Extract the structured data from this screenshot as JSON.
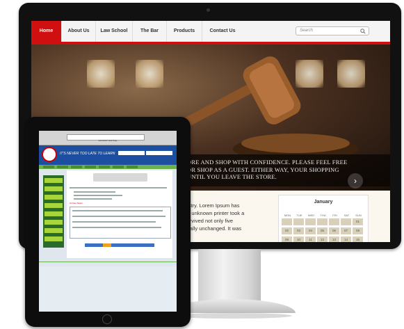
{
  "site": {
    "nav": {
      "items": [
        {
          "label": "Home",
          "active": true
        },
        {
          "label": "About Us",
          "active": false
        },
        {
          "label": "Law School",
          "active": false
        },
        {
          "label": "The Bar",
          "active": false
        },
        {
          "label": "Products",
          "active": false
        },
        {
          "label": "Contact Us",
          "active": false
        }
      ],
      "search_placeholder": "Search"
    },
    "hero": {
      "caption_lines": [
        "ORE AND SHOP WITH CONFIDENCE. PLEASE FEEL FREE",
        "OR SHOP AS A GUEST. EITHER WAY, YOUR SHOPPING",
        "UNTIL YOU LEAVE THE STORE."
      ]
    },
    "lorem_lines": [
      "lustry. Lorem Ipsum has",
      "an unknown printer took a",
      "survived not only five",
      "ntially unchanged. It was"
    ],
    "calendar": {
      "month": "January",
      "days": [
        "MON",
        "TUE",
        "WED",
        "THU",
        "FRI",
        "SAT",
        "SUN"
      ],
      "cells": [
        "",
        "",
        "",
        "",
        "",
        "",
        "01",
        "02",
        "03",
        "04",
        "05",
        "06",
        "07",
        "08",
        "09",
        "10",
        "11",
        "12",
        "13",
        "14",
        "15"
      ]
    }
  },
  "tablet": {
    "tab_title": "FANTAST Test Prep",
    "slogan": "IT'S NEVER TOO LATE TO LEARN",
    "notes_label": "Current Notes"
  },
  "colors": {
    "accent_red": "#d01010",
    "tablet_header_blue": "#1d4fa0",
    "tablet_nav_green": "#6ab04c"
  }
}
